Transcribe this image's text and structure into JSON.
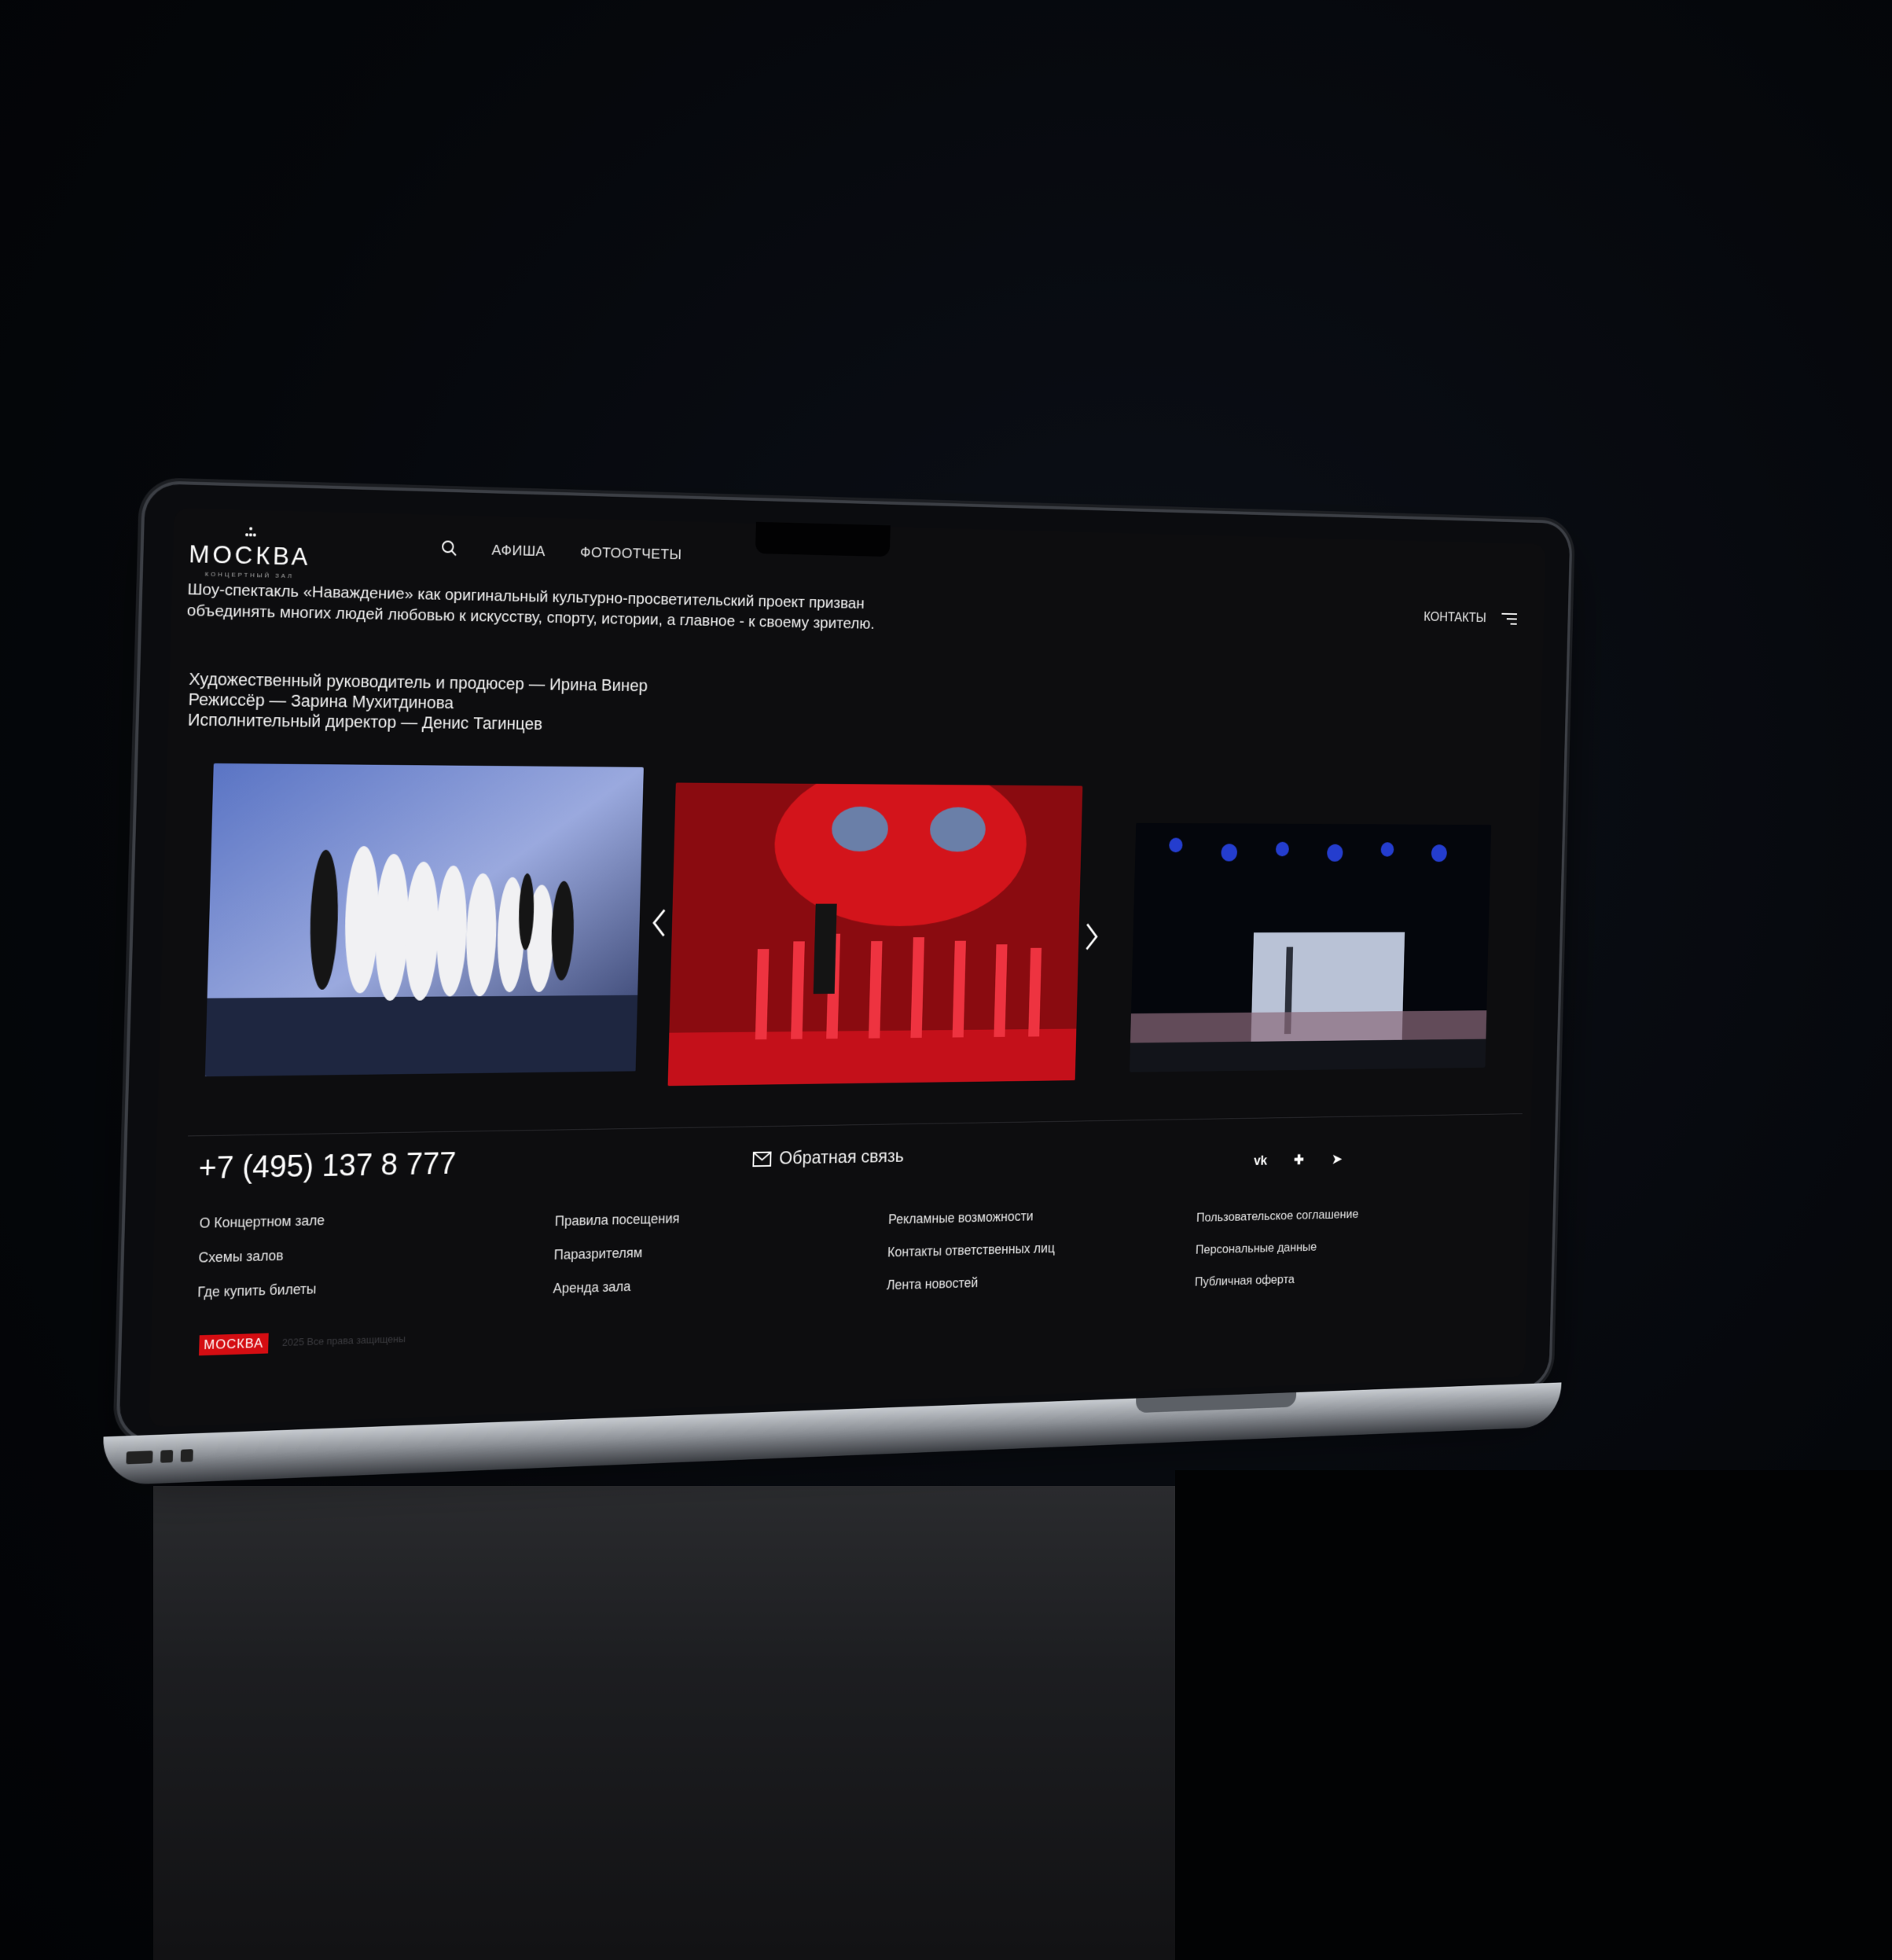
{
  "colors": {
    "accent": "#d40d12",
    "screen_bg": "#0d0d0f",
    "text": "#f2f2f2"
  },
  "header": {
    "logo_text": "МОСКВА",
    "logo_sub": "КОНЦЕРТНЫЙ ЗАЛ",
    "nav": {
      "afisha": "АФИША",
      "photoreports": "ФОТООТЧЕТЫ",
      "contacts": "КОНТАКТЫ"
    },
    "icons": {
      "search": "search-icon",
      "menu": "menu-icon"
    }
  },
  "intro": {
    "text": "Шоу-спектакль «Наваждение» как оригинальный культурно-просветительский проект призван объединять многих людей любовью к искусству, спорту, истории, а главное - к своему зрителю."
  },
  "credits": [
    "Художественный руководитель и продюсер — Ирина Винер",
    "Режиссёр — Зарина Мухитдинова",
    "Исполнительный директор — Денис Тагинцев"
  ],
  "gallery": {
    "icons": {
      "prev": "chevron-left-icon",
      "next": "chevron-right-icon"
    }
  },
  "footer": {
    "phone": "+7 (495) 137 8 777",
    "feedback": "Обратная связь",
    "socials": [
      {
        "name": "vk-icon",
        "glyph": "vk"
      },
      {
        "name": "dzen-icon",
        "glyph": "✚"
      },
      {
        "name": "telegram-icon",
        "glyph": "➤"
      }
    ],
    "col1": [
      "О Концертном зале",
      "Схемы залов",
      "Где купить билеты"
    ],
    "col2": [
      "Правила посещения",
      "Паразрителям",
      "Аренда зала"
    ],
    "col3": [
      "Рекламные возможности",
      "Контакты ответственных лиц",
      "Лента новостей"
    ],
    "col4": [
      "Пользовательское соглашение",
      "Персональные данные",
      "Публичная оферта"
    ],
    "badge": "МОСКВА",
    "copyright": "2025 Все права защищены"
  }
}
